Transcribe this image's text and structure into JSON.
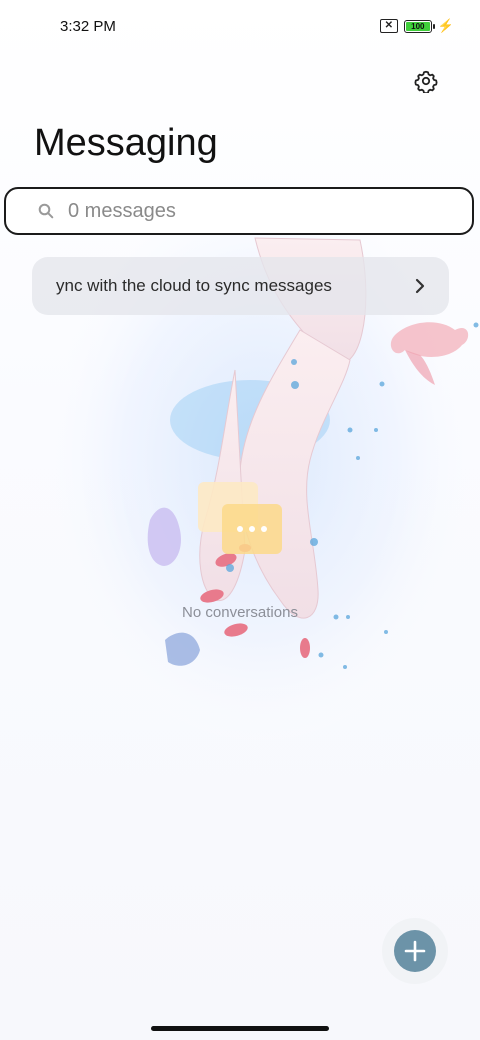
{
  "status_bar": {
    "time": "3:32 PM",
    "sim_icon": "sim-error-icon",
    "battery_level": "100",
    "charging_icon": "bolt-icon"
  },
  "header": {
    "title": "Messaging",
    "settings_icon": "gear-icon"
  },
  "search": {
    "placeholder": "0 messages",
    "value": "",
    "icon": "search-icon"
  },
  "sync_banner": {
    "text": "ync with the cloud to sync messages",
    "icon": "chevron-right-icon"
  },
  "empty_state": {
    "text": "No conversations",
    "icon": "chat-bubbles-icon"
  },
  "fab": {
    "icon": "plus-icon"
  },
  "colors": {
    "fab_accent": "#6c93a8",
    "search_border": "#1b1b1b",
    "banner_bg": "#e4e6ec",
    "empty_text": "#8c8f98"
  }
}
